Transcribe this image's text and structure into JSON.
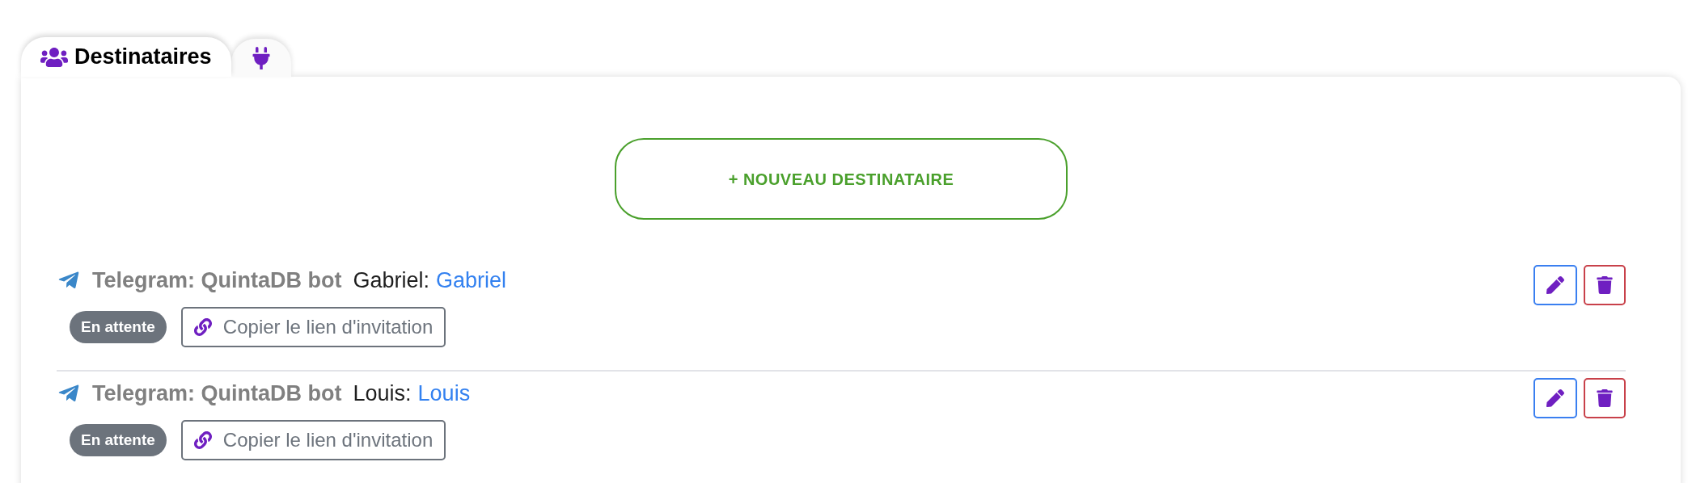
{
  "tabs": [
    {
      "label": "Destinataires",
      "selected": true
    },
    {
      "selected": false
    }
  ],
  "new_button": "+ NOUVEAU DESTINATAIRE",
  "recipients": [
    {
      "service": "Telegram: QuintaDB bot",
      "name_label": "Gabriel:",
      "name_link": "Gabriel",
      "status": "En attente",
      "copy_button": "Copier le lien d'invitation"
    },
    {
      "service": "Telegram: QuintaDB bot",
      "name_label": "Louis:",
      "name_link": "Louis",
      "status": "En attente",
      "copy_button": "Copier le lien d'invitation"
    }
  ]
}
